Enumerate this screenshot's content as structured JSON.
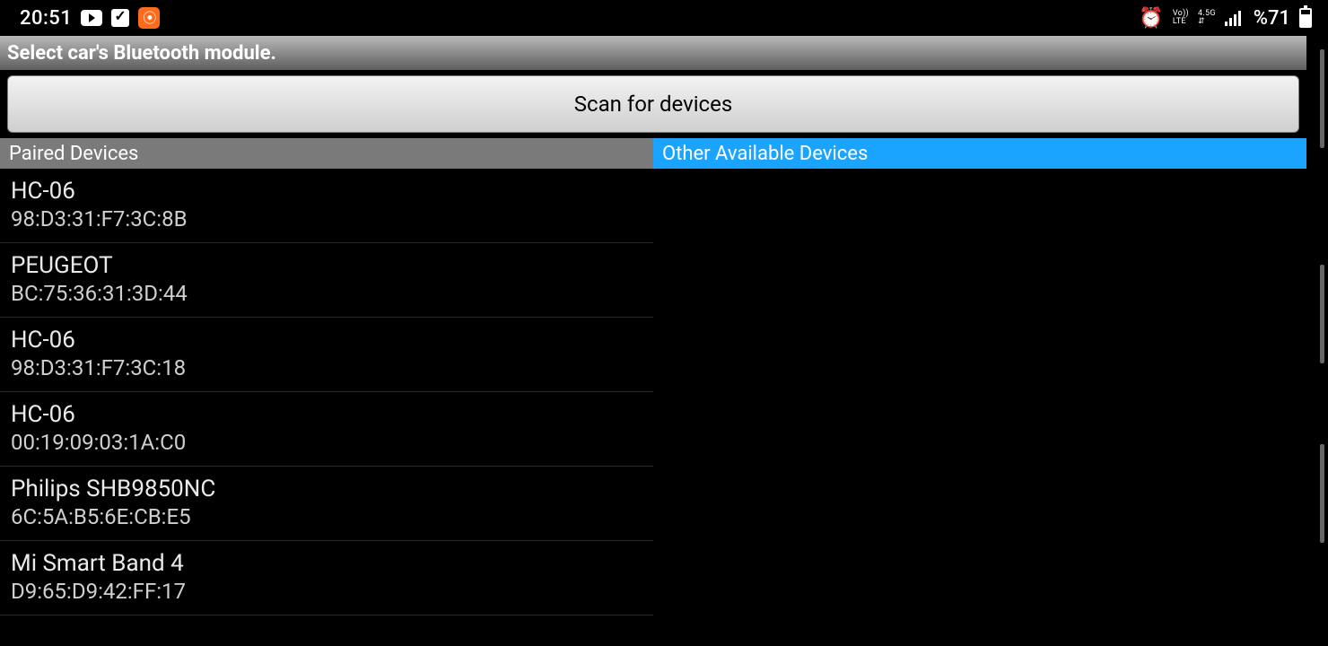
{
  "statusbar": {
    "time": "20:51",
    "volte_top": "Vo))",
    "volte_bot": "LTE",
    "net": "4.5G",
    "battery_text": "%71"
  },
  "titlebar": {
    "text": "Select car's Bluetooth module."
  },
  "scan_button": {
    "label": "Scan for devices"
  },
  "headers": {
    "paired": "Paired Devices",
    "other": "Other Available Devices"
  },
  "paired_devices": [
    {
      "name": "HC-06",
      "mac": "98:D3:31:F7:3C:8B"
    },
    {
      "name": "PEUGEOT",
      "mac": "BC:75:36:31:3D:44"
    },
    {
      "name": "HC-06",
      "mac": "98:D3:31:F7:3C:18"
    },
    {
      "name": "HC-06",
      "mac": "00:19:09:03:1A:C0"
    },
    {
      "name": "Philips SHB9850NC",
      "mac": "6C:5A:B5:6E:CB:E5"
    },
    {
      "name": "Mi Smart Band 4",
      "mac": "D9:65:D9:42:FF:17"
    }
  ],
  "other_devices": []
}
